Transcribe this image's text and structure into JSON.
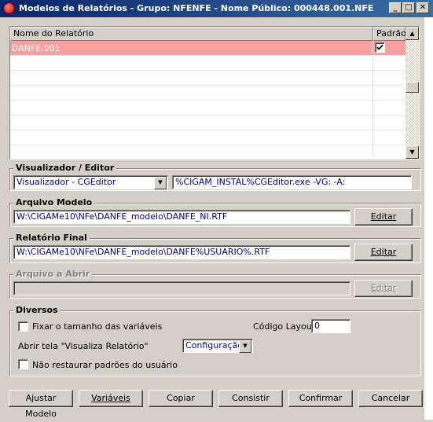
{
  "window": {
    "title": "Modelos de Relatórios - Grupo: NFENFE - Nome Público: 000448.001.NFE",
    "minimize": "_",
    "maximize": "□",
    "close": "✕"
  },
  "grid": {
    "col_name": "Nome do Relatório",
    "col_default": "Padrão",
    "rows": [
      {
        "name": "DANFE.001",
        "default": true
      }
    ]
  },
  "viewer": {
    "label": "Visualizador / Editor",
    "selected": "Visualizador - CGEditor",
    "command": "%CIGAM_INSTAL%CGEditor.exe -VG: -A:"
  },
  "model_file": {
    "label": "Arquivo Modelo",
    "path": "W:\\CIGAMe10\\NFe\\DANFE_modelo\\DANFE_NI.RTF",
    "edit": "Editar"
  },
  "final_report": {
    "label": "Relatório Final",
    "path": "W:\\CIGAMe10\\NFe\\DANFE_modelo\\DANFE%USUARIO%.RTF",
    "edit": "Editar"
  },
  "open_file": {
    "label": "Arquivo a Abrir",
    "path": "",
    "edit": "Editar"
  },
  "misc": {
    "label": "Diversos",
    "fix_size": "Fixar o tamanho das variáveis",
    "layout_code_label": "Código Layout",
    "layout_code": "0",
    "open_screen_label": "Abrir tela \"Visualiza Relatório\"",
    "open_screen_value": "Configuração",
    "no_restore": "Não restaurar padrões do usuário"
  },
  "buttons": {
    "adjust": "Ajustar Modelo",
    "variables": "Variáveis",
    "copy": "Copiar",
    "check": "Consistir",
    "confirm": "Confirmar",
    "cancel": "Cancelar"
  }
}
